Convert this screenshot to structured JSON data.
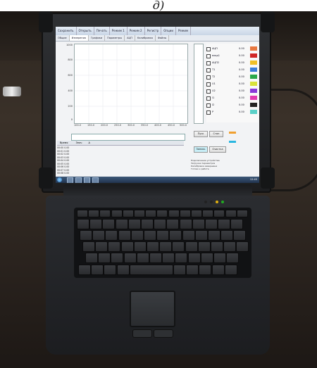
{
  "caption": "д)",
  "screen": {
    "toolbar": [
      "Сохранить",
      "Открыть",
      "Печать",
      "Режим 1",
      "Режим 2",
      "Регистр",
      "Опции",
      "Режим"
    ],
    "tabs": [
      "Общие",
      "Измерения",
      "Графики",
      "Параметры",
      "АЦП",
      "Калибровка",
      "Файлы"
    ],
    "active_tab": 1,
    "y_ticks": [
      "1000",
      "800",
      "600",
      "400",
      "200",
      "0"
    ],
    "x_ticks": [
      "100.0",
      "150.0",
      "200.0",
      "250.0",
      "300.0",
      "350.0",
      "400.0",
      "450.0",
      "500.0"
    ],
    "channels": [
      {
        "name": "АЦП",
        "value": "0.00",
        "color": "#e87840"
      },
      {
        "name": "вход1",
        "value": "0.00",
        "color": "#d02626"
      },
      {
        "name": "АЦП2",
        "value": "0.00",
        "color": "#f0c028"
      },
      {
        "name": "T1",
        "value": "0.00",
        "color": "#3b7dd8"
      },
      {
        "name": "T2",
        "value": "0.00",
        "color": "#2aa84a"
      },
      {
        "name": "U1",
        "value": "0.00",
        "color": "#d8e23a"
      },
      {
        "name": "U2",
        "value": "0.00",
        "color": "#8a3ad8"
      },
      {
        "name": "I1",
        "value": "0.00",
        "color": "#e23ab0"
      },
      {
        "name": "I2",
        "value": "0.00",
        "color": "#222222"
      },
      {
        "name": "P",
        "value": "0.00",
        "color": "#5ad0c8"
      }
    ],
    "controls": {
      "start_label": "Пуск",
      "stop_label": "Стоп",
      "record_label": "Запись",
      "clear_label": "Очистка"
    },
    "list_header": [
      "Время",
      "Знач",
      "Δ"
    ],
    "list_rows": [
      "00:00 0.00",
      "00:01 0.00",
      "00:02 0.00",
      "00:03 0.00",
      "00:04 0.00",
      "00:05 0.00",
      "00:06 0.00",
      "00:07 0.00",
      "00:08 0.00"
    ],
    "notes": [
      "Подключение устройства",
      "Загрузка параметров",
      "Калибровка завершена",
      "Готово к работе"
    ],
    "clock": "12:45"
  }
}
